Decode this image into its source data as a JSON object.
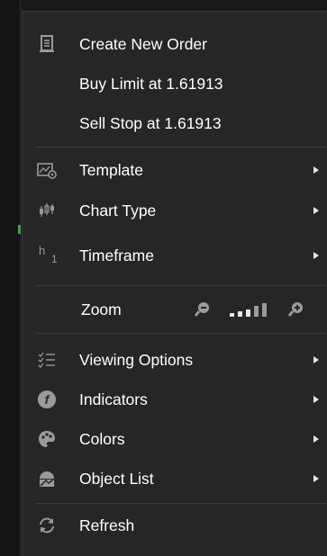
{
  "menu": {
    "create_order": {
      "label": "Create New Order",
      "icon": "order-document-icon"
    },
    "buy_limit": {
      "label": "Buy Limit at 1.61913"
    },
    "sell_stop": {
      "label": "Sell Stop at 1.61913"
    },
    "template": {
      "label": "Template",
      "icon": "template-icon"
    },
    "chart_type": {
      "label": "Chart Type",
      "icon": "candlestick-icon"
    },
    "timeframe": {
      "label": "Timeframe",
      "icon": "timeframe-icon",
      "icon_text_h": "h",
      "icon_text_1": "1"
    },
    "zoom": {
      "label": "Zoom",
      "zoom_out_icon": "zoom-out-icon",
      "zoom_in_icon": "zoom-in-icon",
      "level_icon": "zoom-level-bars-icon"
    },
    "viewing_options": {
      "label": "Viewing Options",
      "icon": "checklist-icon"
    },
    "indicators": {
      "label": "Indicators",
      "icon": "indicators-icon",
      "icon_glyph": "f"
    },
    "colors": {
      "label": "Colors",
      "icon": "palette-icon"
    },
    "object_list": {
      "label": "Object List",
      "icon": "object-list-icon"
    },
    "refresh": {
      "label": "Refresh",
      "icon": "refresh-icon"
    }
  },
  "colors": {
    "menu_bg": "#262626",
    "text": "#ffffff",
    "icon": "#9a9a9a",
    "separator": "#3c3c3c"
  }
}
